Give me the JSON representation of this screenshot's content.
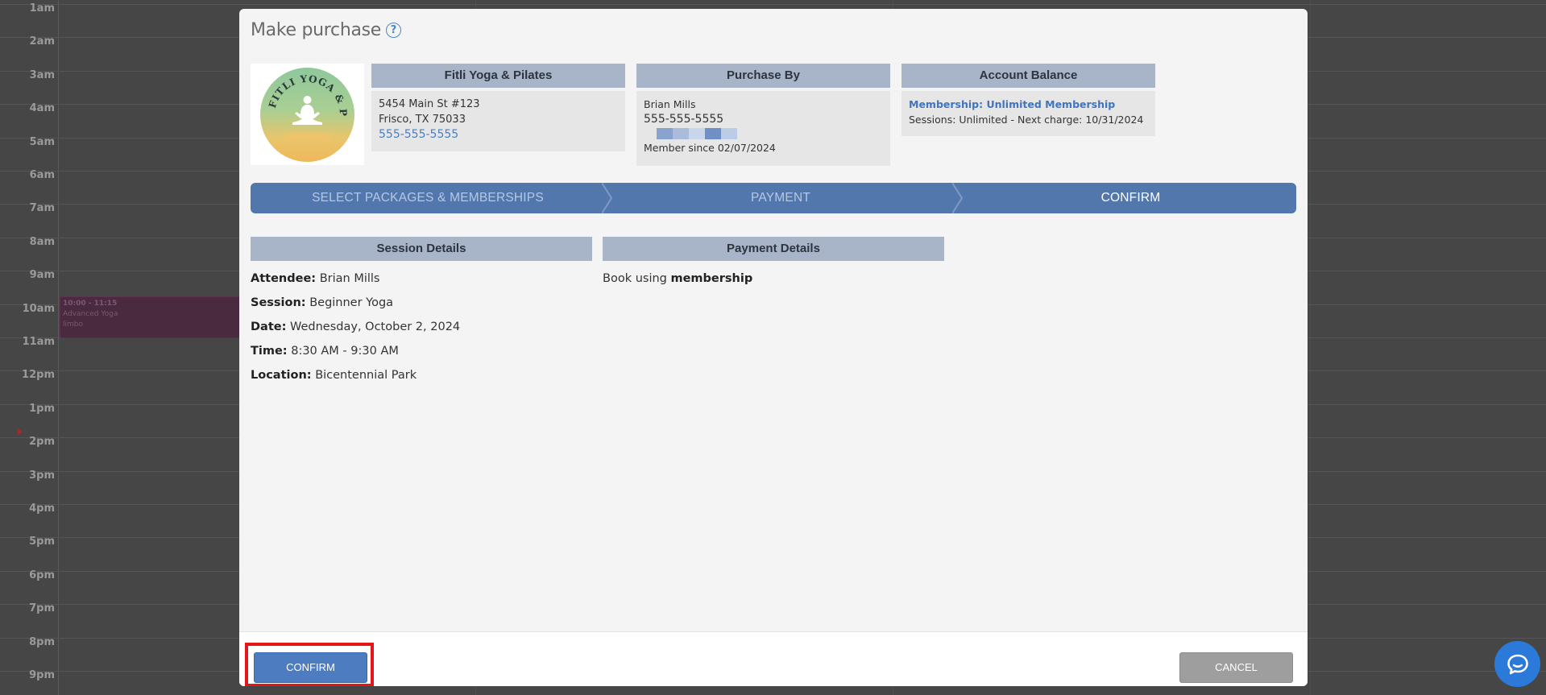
{
  "calendar": {
    "hours": [
      "1am",
      "2am",
      "3am",
      "4am",
      "5am",
      "6am",
      "7am",
      "8am",
      "9am",
      "10am",
      "11am",
      "12pm",
      "1pm",
      "2pm",
      "3pm",
      "4pm",
      "5pm",
      "6pm",
      "7pm",
      "8pm",
      "9pm"
    ],
    "event": {
      "time": "10:00 - 11:15",
      "title": "Advanced Yoga",
      "location": "limbo"
    }
  },
  "modal": {
    "title": "Make purchase",
    "help_icon": "?",
    "studio": {
      "header": "Fitli Yoga & Pilates",
      "address_line1": "5454 Main St #123",
      "address_line2": "Frisco, TX 75033",
      "phone": "555-555-5555",
      "logo_text": "FITLI YOGA & PILATES"
    },
    "purchase_by": {
      "header": "Purchase By",
      "name": "Brian Mills",
      "phone": "555-555-5555",
      "member_since": "Member since 02/07/2024"
    },
    "account_balance": {
      "header": "Account Balance",
      "membership": "Membership: Unlimited Membership",
      "sessions": "Sessions: Unlimited -  Next charge: 10/31/2024"
    },
    "steps": [
      "SELECT PACKAGES & MEMBERSHIPS",
      "PAYMENT",
      "CONFIRM"
    ],
    "session_details": {
      "header": "Session Details",
      "attendee_label": "Attendee:",
      "attendee": "Brian Mills",
      "session_label": "Session:",
      "session": "Beginner Yoga",
      "date_label": "Date:",
      "date": "Wednesday, October 2, 2024",
      "time_label": "Time:",
      "time": "8:30 AM - 9:30 AM",
      "location_label": "Location:",
      "location": "Bicentennial Park"
    },
    "payment_details": {
      "header": "Payment Details",
      "text": "Book using",
      "method": "membership"
    },
    "footer": {
      "confirm_label": "CONFIRM",
      "cancel_label": "CANCEL"
    }
  },
  "colors": {
    "accent": "#4d7cc0",
    "stepper": "#5277ad",
    "card_header": "#a8b4c8",
    "highlight": "#e5161a",
    "chat": "#2b7ad9"
  },
  "icons": {
    "help": "help-circle-icon",
    "chat": "chat-bubble-icon"
  }
}
